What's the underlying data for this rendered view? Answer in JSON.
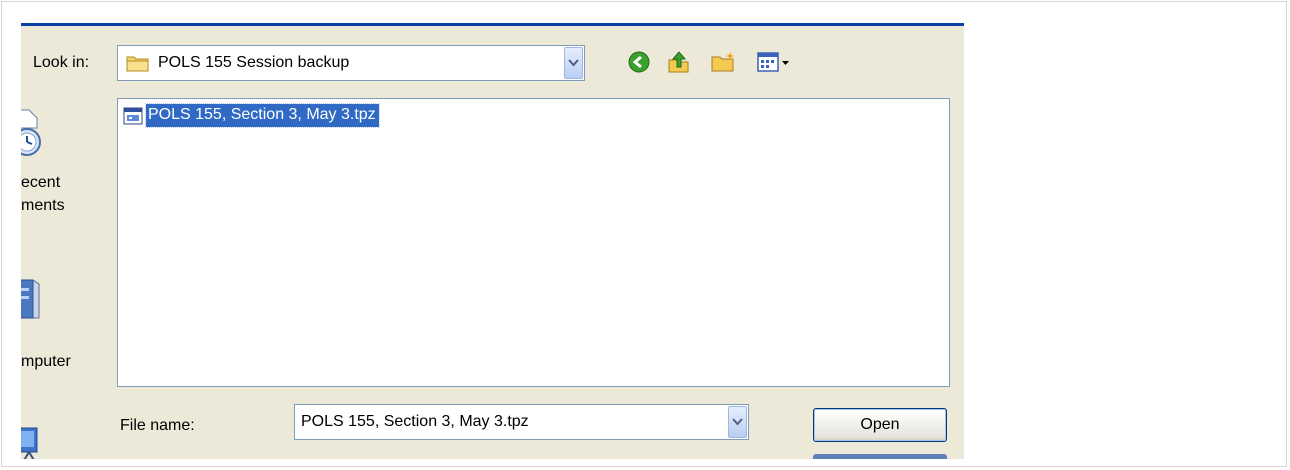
{
  "look_in": {
    "label": "Look in:",
    "value": "POLS 155 Session backup"
  },
  "toolbar": {
    "icons": [
      "back-icon",
      "up-folder-icon",
      "new-folder-icon",
      "view-menu-icon"
    ]
  },
  "places": [
    {
      "line1": "ecent",
      "line2": "ments",
      "icon": "recent-documents-icon"
    },
    {
      "line1": "mputer",
      "icon": "my-computer-icon"
    },
    {
      "icon": "network-places-icon"
    }
  ],
  "files": [
    {
      "name": "POLS 155, Section 3, May 3.tpz",
      "icon": "tpz-file-icon",
      "selected": true
    }
  ],
  "file_name": {
    "label": "File name:",
    "value": "POLS 155, Section 3, May 3.tpz"
  },
  "buttons": {
    "open": "Open"
  },
  "colors": {
    "dialog_bg": "#ece9d8",
    "selection": "#316ac5",
    "title_bar": "#0a3fa8"
  }
}
